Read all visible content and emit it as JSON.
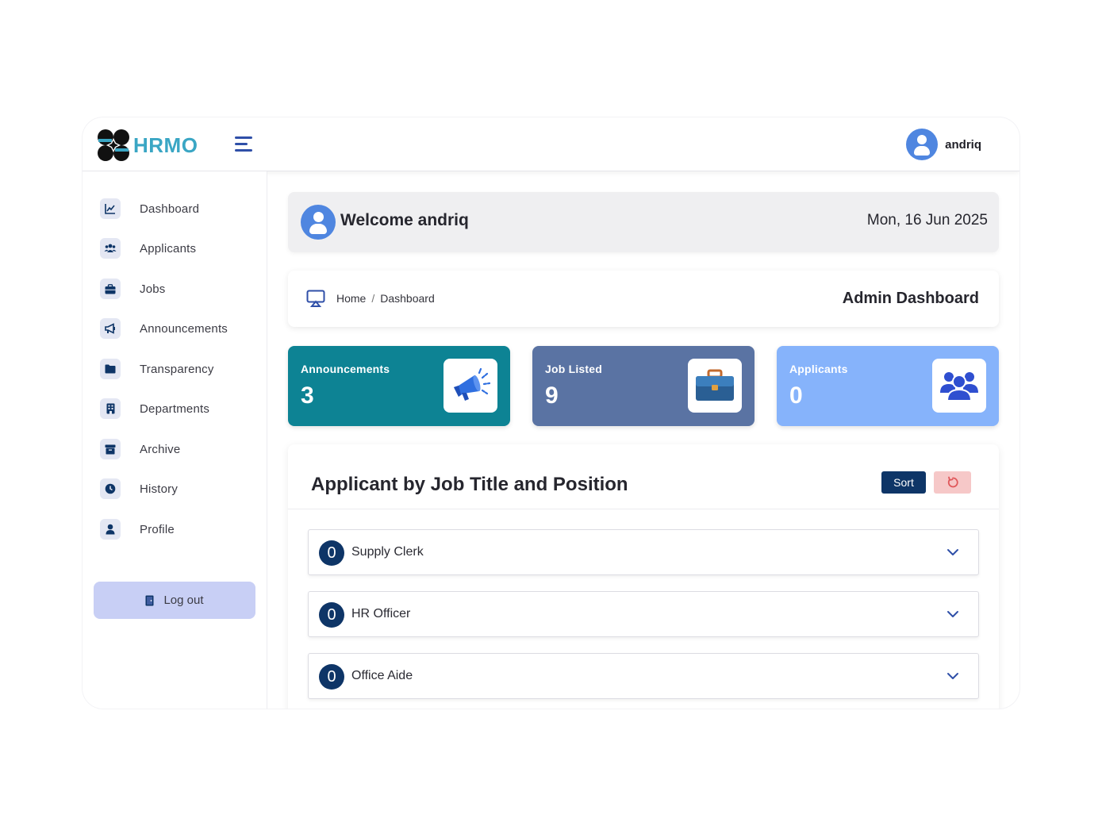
{
  "brand": {
    "name": "HRMO"
  },
  "header": {
    "username": "andriq"
  },
  "sidebar": {
    "items": [
      {
        "label": "Dashboard",
        "icon": "chart-line-icon"
      },
      {
        "label": "Applicants",
        "icon": "users-icon"
      },
      {
        "label": "Jobs",
        "icon": "briefcase-icon"
      },
      {
        "label": "Announcements",
        "icon": "megaphone-icon"
      },
      {
        "label": "Transparency",
        "icon": "folder-icon"
      },
      {
        "label": "Departments",
        "icon": "building-icon"
      },
      {
        "label": "Archive",
        "icon": "archive-icon"
      },
      {
        "label": "History",
        "icon": "clock-icon"
      },
      {
        "label": "Profile",
        "icon": "user-icon"
      }
    ],
    "logout_label": "Log out"
  },
  "welcome": {
    "text": "Welcome andriq",
    "date": "Mon, 16 Jun 2025"
  },
  "breadcrumb": {
    "home": "Home",
    "separator": "/",
    "current": "Dashboard",
    "page_title": "Admin Dashboard"
  },
  "cards": [
    {
      "title": "Announcements",
      "value": "3",
      "color": "#0d8394",
      "icon": "megaphone-icon"
    },
    {
      "title": "Job Listed",
      "value": "9",
      "color": "#5a73a3",
      "icon": "briefcase-icon"
    },
    {
      "title": "Applicants",
      "value": "0",
      "color": "#86b3fb",
      "icon": "users-icon"
    }
  ],
  "panel": {
    "title": "Applicant by Job Title and Position",
    "sort_label": "Sort",
    "jobs": [
      {
        "count": "0",
        "title": "Supply Clerk"
      },
      {
        "count": "0",
        "title": "HR Officer"
      },
      {
        "count": "0",
        "title": "Office Aide"
      }
    ]
  },
  "colors": {
    "brand": "#3aa6c4",
    "navy": "#0e3567",
    "accent_blue": "#4f86e0"
  }
}
